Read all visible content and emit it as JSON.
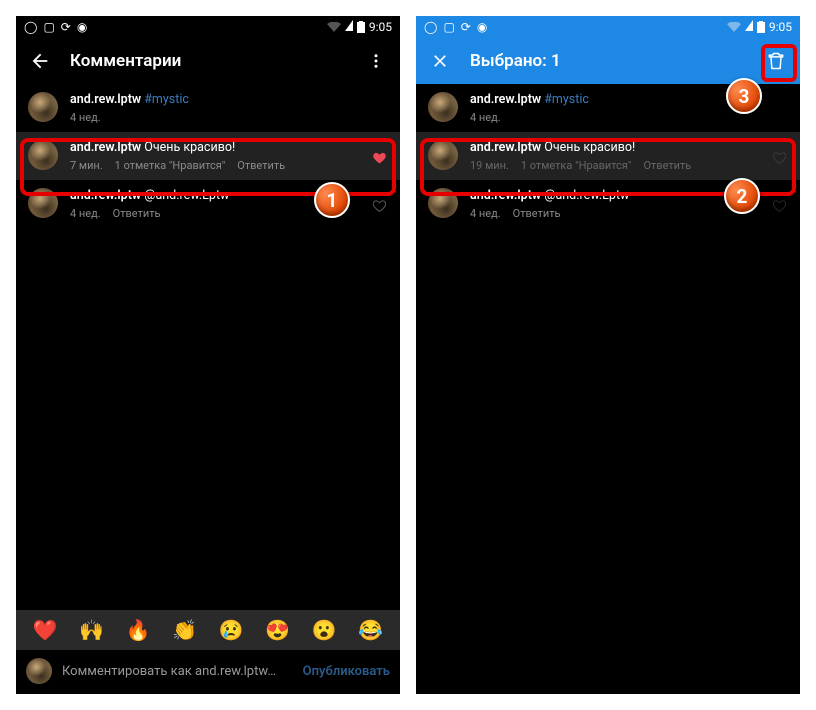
{
  "status": {
    "time": "9:05"
  },
  "left": {
    "header_title": "Комментарии",
    "comments": [
      {
        "user": "and.rew.lptw",
        "text": "#mystic",
        "hashtag": true,
        "time": "4 нед.",
        "likes": "",
        "reply": ""
      },
      {
        "user": "and.rew.lptw",
        "text": "Очень красиво!",
        "hashtag": false,
        "time": "7 мин.",
        "likes": "1 отметка \"Нравится\"",
        "reply": "Ответить"
      },
      {
        "user": "and.rew.lptw",
        "text": "@and.rew.Lptw",
        "hashtag": false,
        "time": "4 нед.",
        "likes": "",
        "reply": "Ответить"
      }
    ],
    "emoji": [
      "❤️",
      "🙌",
      "🔥",
      "👏",
      "😢",
      "😍",
      "😮",
      "😂"
    ],
    "composer_placeholder": "Комментировать как and.rew.lptw…",
    "composer_post": "Опубликовать"
  },
  "right": {
    "header_title": "Выбрано: 1",
    "comments": [
      {
        "user": "and.rew.lptw",
        "text": "#mystic",
        "hashtag": true,
        "time": "4 нед.",
        "likes": "",
        "reply": ""
      },
      {
        "user": "and.rew.lptw",
        "text": "Очень красиво!",
        "hashtag": false,
        "time": "19 мин.",
        "likes": "1 отметка \"Нравится\"",
        "reply": "Ответить"
      },
      {
        "user": "and.rew.lptw",
        "text": "@and.rew.Lptw",
        "hashtag": false,
        "time": "4 нед.",
        "likes": "",
        "reply": "Ответить"
      }
    ]
  },
  "badges": {
    "b1": "1",
    "b2": "2",
    "b3": "3"
  }
}
